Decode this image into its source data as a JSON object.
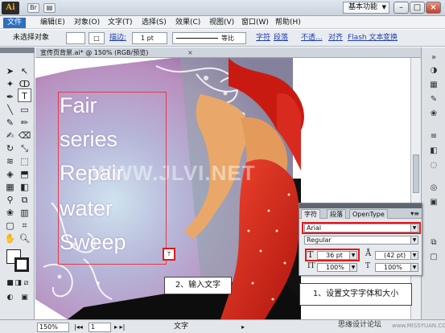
{
  "titlebar": {
    "app_logo": "Ai",
    "workspace": "基本功能",
    "mini_buttons": [
      "Br",
      "▤"
    ]
  },
  "menu": {
    "items": [
      "文件(F)",
      "编辑(E)",
      "对象(O)",
      "文字(T)",
      "选择(S)",
      "效果(C)",
      "视图(V)",
      "窗口(W)",
      "帮助(H)"
    ]
  },
  "controlbar": {
    "no_selection": "未选择对象",
    "stroke_label": "描边:",
    "stroke_weight": "1 pt",
    "stroke_profile": "等比",
    "links": [
      "字符",
      "段落",
      "不透...",
      "对齐",
      "Flash 文本",
      "变换"
    ]
  },
  "document": {
    "tab_label": "宣传页背景.ai* @ 150% (RGB/预览)",
    "close": "×"
  },
  "artwork": {
    "lines": [
      "Fair",
      "series",
      "Repair",
      "water",
      "Sweep"
    ],
    "watermark": "WWW.JLVI.NET",
    "cursor_icon": "T"
  },
  "callouts": {
    "step2": "2、输入文字",
    "step1": "1、设置文字字体和大小"
  },
  "character_panel": {
    "tabs": [
      "字符",
      "段落",
      "OpenType"
    ],
    "font_family": "Arial",
    "font_style": "Regular",
    "font_size": "36 pt",
    "leading": "(42 pt)",
    "vertical_scale": "100%",
    "horizontal_scale": "100%"
  },
  "statusbar": {
    "zoom": "150%",
    "page": "1",
    "tool_label": "文字",
    "credit": "思缘设计论坛",
    "credit2": "www.MISSYUAN.COM"
  },
  "colors": {
    "accent_red": "#e01919",
    "menu_highlight": "#2f6fbd",
    "dress_red": "#d92a1f",
    "skin": "#e9a869"
  },
  "icons": [
    "select-icon",
    "direct-select-icon",
    "pen-icon",
    "type-icon",
    "line-icon",
    "rect-icon",
    "brush-icon",
    "pencil-icon",
    "rotate-icon",
    "scale-icon",
    "warp-icon",
    "free-transform-icon",
    "symbol-icon",
    "graph-icon",
    "mesh-icon",
    "gradient-icon",
    "eyedropper-icon",
    "blend-icon",
    "slice-icon",
    "eraser-icon",
    "hand-icon",
    "zoom-icon"
  ]
}
